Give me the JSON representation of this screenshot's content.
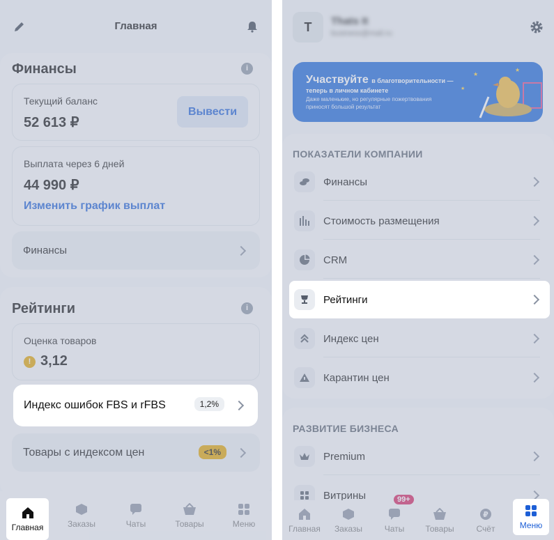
{
  "left": {
    "header": {
      "title": "Главная"
    },
    "finance": {
      "title": "Финансы",
      "info_icon": "i",
      "balance_label": "Текущий баланс",
      "balance_value": "52 613 ₽",
      "withdraw_label": "Вывести",
      "payout_label": "Выплата через 6 дней",
      "payout_value": "44 990 ₽",
      "schedule_link": "Изменить график выплат",
      "finance_row": "Финансы"
    },
    "ratings": {
      "title": "Рейтинги",
      "info_icon": "i",
      "goods_label": "Оценка товаров",
      "goods_value": "3,12",
      "error_index_label": "Индекс ошибок FBS и rFBS",
      "error_index_value": "1,2%",
      "price_index_label": "Товары с индексом цен",
      "price_index_value": "<1%"
    },
    "tabs": [
      {
        "label": "Главная",
        "icon": "home-icon"
      },
      {
        "label": "Заказы",
        "icon": "box-icon"
      },
      {
        "label": "Чаты",
        "icon": "chat-icon"
      },
      {
        "label": "Товары",
        "icon": "basket-icon"
      },
      {
        "label": "Меню",
        "icon": "grid-icon"
      }
    ]
  },
  "right": {
    "header": {
      "avatar_letter": "T",
      "account_name": "Thats It",
      "account_email": "business@mail.ru"
    },
    "banner": {
      "headline": "Участвуйте",
      "headline_small": "в благотворительности —",
      "headline_line2": "теперь в личном кабинете",
      "subtext_line1": "Даже маленькие, но регулярные пожертвования",
      "subtext_line2": "приносят большой результат"
    },
    "company_section": {
      "title": "ПОКАЗАТЕЛИ КОМПАНИИ",
      "items": [
        {
          "label": "Финансы",
          "icon": "coins-icon"
        },
        {
          "label": "Стоимость размещения",
          "icon": "bars-icon"
        },
        {
          "label": "CRM",
          "icon": "pie-chart-icon"
        },
        {
          "label": "Рейтинги",
          "icon": "trophy-icon"
        },
        {
          "label": "Индекс цен",
          "icon": "double-chevron-up-icon"
        },
        {
          "label": "Карантин цен",
          "icon": "triangle-icon"
        }
      ]
    },
    "business_section": {
      "title": "РАЗВИТИЕ БИЗНЕСА",
      "items": [
        {
          "label": "Premium",
          "icon": "crown-icon"
        },
        {
          "label": "Витрины",
          "icon": "grid-icon"
        }
      ]
    },
    "tabs": [
      {
        "label": "Главная",
        "icon": "home-icon"
      },
      {
        "label": "Заказы",
        "icon": "box-icon"
      },
      {
        "label": "Чаты",
        "icon": "chat-icon",
        "badge": "99+"
      },
      {
        "label": "Товары",
        "icon": "basket-icon"
      },
      {
        "label": "Счёт",
        "icon": "ruble-icon"
      },
      {
        "label": "Меню",
        "icon": "grid-icon"
      }
    ]
  },
  "colors": {
    "accent": "#1d5fd6",
    "warning": "#e2a400",
    "badge_red": "#d6235f",
    "banner_bg": "#1b67d9"
  }
}
